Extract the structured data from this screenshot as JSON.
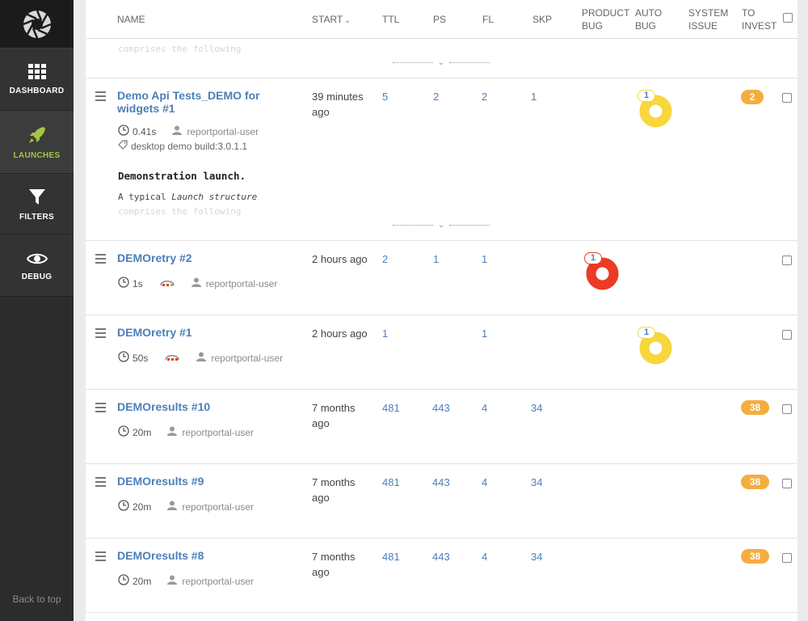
{
  "sidebar": {
    "items": [
      {
        "label": "DASHBOARD",
        "icon": "grid-icon"
      },
      {
        "label": "LAUNCHES",
        "icon": "rocket-icon",
        "active": true
      },
      {
        "label": "FILTERS",
        "icon": "filter-icon"
      },
      {
        "label": "DEBUG",
        "icon": "eye-icon"
      }
    ],
    "back_to_top": "Back to top"
  },
  "header": {
    "name": "NAME",
    "start": "START",
    "ttl": "TTL",
    "ps": "PS",
    "fl": "FL",
    "skp": "SKP",
    "product_bug": [
      "PRODUCT",
      "BUG"
    ],
    "auto_bug": [
      "AUTO",
      "BUG"
    ],
    "system_issue": [
      "SYSTEM",
      "ISSUE"
    ],
    "to_invest": [
      "TO",
      "INVEST"
    ]
  },
  "top_fragment": {
    "fade_text": "comprises the following"
  },
  "launches": [
    {
      "name": "Demo Api Tests_DEMO for widgets #1",
      "duration": "0.41s",
      "user": "reportportal-user",
      "attribute": "desktop demo build:3.0.1.1",
      "start": "39 minutes ago",
      "ttl": "5",
      "ps": "2",
      "fl": "2",
      "skp": "1",
      "auto_bug": "1",
      "to_invest": "2",
      "description_title": "Demonstration launch.",
      "description_text_prefix": "A typical ",
      "description_text_italic": "Launch structure",
      "description_fade": "comprises the following"
    },
    {
      "name": "DEMOretry #2",
      "duration": "1s",
      "user": "reportportal-user",
      "start": "2 hours ago",
      "ttl": "2",
      "ps": "1",
      "fl": "1",
      "product_bug": "1"
    },
    {
      "name": "DEMOretry #1",
      "duration": "50s",
      "user": "reportportal-user",
      "start": "2 hours ago",
      "ttl": "1",
      "fl": "1",
      "auto_bug": "1"
    },
    {
      "name": "DEMOresults #10",
      "duration": "20m",
      "user": "reportportal-user",
      "start": "7 months ago",
      "ttl": "481",
      "ps": "443",
      "fl": "4",
      "skp": "34",
      "to_invest": "38"
    },
    {
      "name": "DEMOresults #9",
      "duration": "20m",
      "user": "reportportal-user",
      "start": "7 months ago",
      "ttl": "481",
      "ps": "443",
      "fl": "4",
      "skp": "34",
      "to_invest": "38"
    },
    {
      "name": "DEMOresults #8",
      "duration": "20m",
      "user": "reportportal-user",
      "start": "7 months ago",
      "ttl": "481",
      "ps": "443",
      "fl": "4",
      "skp": "34",
      "to_invest": "38"
    }
  ],
  "colors": {
    "accent": "#a3c644",
    "link": "#4c7fb8",
    "to_invest": "#f6ad3f",
    "auto_bug": "#f7d63e",
    "product_bug": "#ec3a24"
  }
}
